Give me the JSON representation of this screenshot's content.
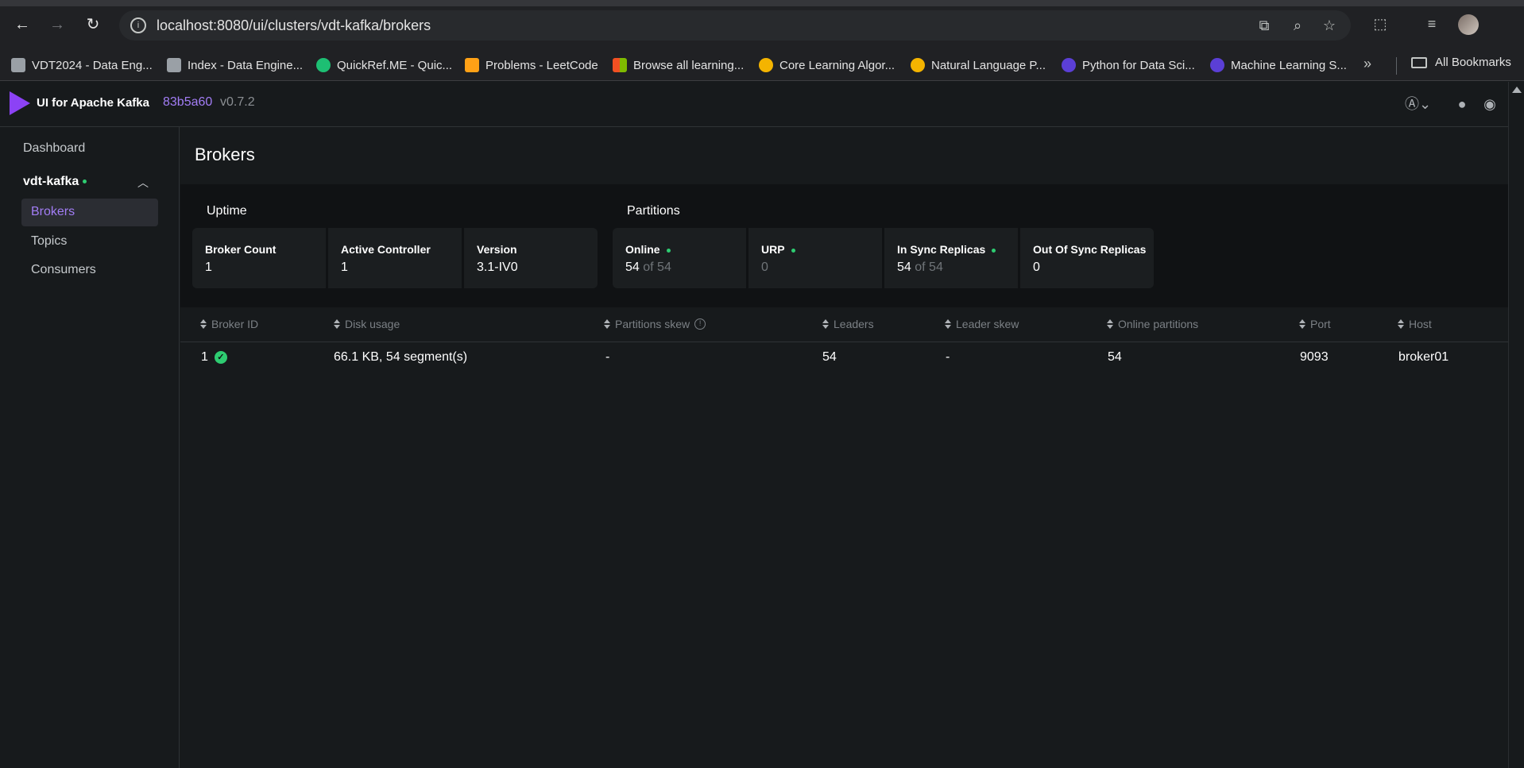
{
  "browser": {
    "url": "localhost:8080/ui/clusters/vdt-kafka/brokers",
    "bookmarks": [
      {
        "label": "VDT2024 - Data Eng...",
        "color": "#9aa0a6"
      },
      {
        "label": "Index - Data Engine...",
        "color": "#9aa0a6"
      },
      {
        "label": "QuickRef.ME - Quic...",
        "color": "#1dbf73"
      },
      {
        "label": "Problems - LeetCode",
        "color": "#ffa116"
      },
      {
        "label": "Browse all learning...",
        "color": "#f25022"
      },
      {
        "label": "Core Learning Algor...",
        "color": "#f4b400"
      },
      {
        "label": "Natural Language P...",
        "color": "#f4b400"
      },
      {
        "label": "Python for Data Sci...",
        "color": "#5b3fd6"
      },
      {
        "label": "Machine Learning S...",
        "color": "#5b3fd6"
      }
    ],
    "all_bookmarks": "All Bookmarks"
  },
  "app": {
    "logo_text": "UI for Apache Kafka",
    "commit": "83b5a60",
    "version": "v0.7.2",
    "accent": "#a27df5"
  },
  "sidebar": {
    "dashboard": "Dashboard",
    "cluster": "vdt-kafka",
    "items": [
      "Brokers",
      "Topics",
      "Consumers"
    ]
  },
  "page": {
    "title": "Brokers",
    "uptime": {
      "title": "Uptime",
      "cards": [
        {
          "label": "Broker Count",
          "value": "1"
        },
        {
          "label": "Active Controller",
          "value": "1"
        },
        {
          "label": "Version",
          "value": "3.1-IV0"
        }
      ]
    },
    "partitions": {
      "title": "Partitions",
      "cards": [
        {
          "label": "Online",
          "value": "54",
          "sub": "of 54"
        },
        {
          "label": "URP",
          "value": "0"
        },
        {
          "label": "In Sync Replicas",
          "value": "54",
          "sub": "of 54"
        },
        {
          "label": "Out Of Sync Replicas",
          "value": "0"
        }
      ]
    },
    "table": {
      "columns": [
        "Broker ID",
        "Disk usage",
        "Partitions skew",
        "Leaders",
        "Leader skew",
        "Online partitions",
        "Port",
        "Host"
      ],
      "rows": [
        {
          "broker_id": "1",
          "disk_usage": "66.1 KB, 54 segment(s)",
          "partitions_skew": "-",
          "leaders": "54",
          "leader_skew": "-",
          "online_partitions": "54",
          "port": "9093",
          "host": "broker01"
        }
      ]
    }
  }
}
